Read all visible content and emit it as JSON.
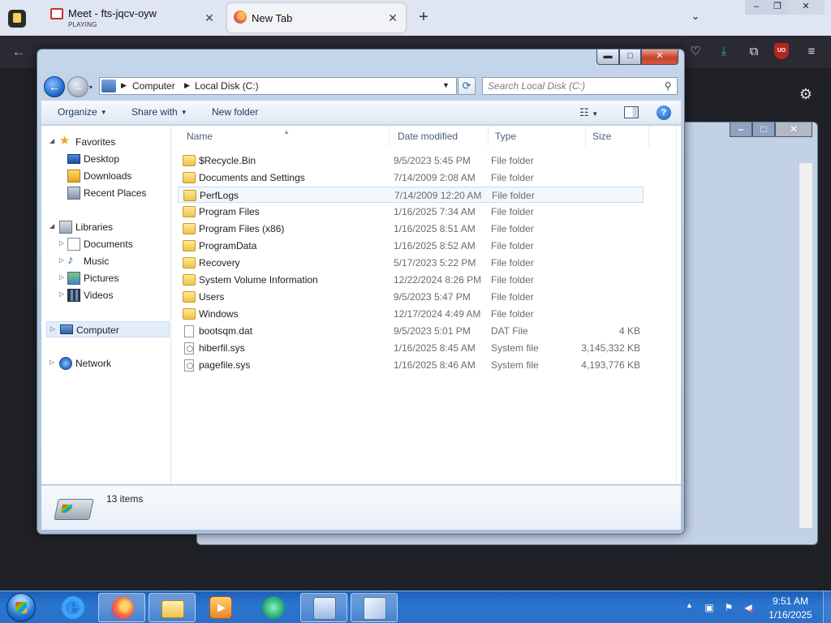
{
  "browser": {
    "tabs": [
      {
        "title": "Meet - fts-jqcv-oyw",
        "subtitle": "PLAYING",
        "active": false
      },
      {
        "title": "New Tab",
        "active": true
      }
    ],
    "icons": {
      "back": "arrow-left-icon",
      "pocket": "pocket-icon",
      "downloads": "download-arrow-icon",
      "extensions": "puzzle-icon",
      "ublock": "ublock-origin-icon",
      "menu": "hamburger-menu-icon",
      "settings": "gear-icon"
    },
    "ublock_label": "UO",
    "colors": {
      "tabbar": "#dfe6f2",
      "navbar": "#2b2a33",
      "content": "#1f2126",
      "accent": "#1fb3c7"
    }
  },
  "explorer": {
    "address": {
      "crumbs": [
        "Computer",
        "Local Disk (C:)"
      ]
    },
    "search": {
      "placeholder": "Search Local Disk (C:)"
    },
    "toolbar": {
      "organize": "Organize",
      "share_with": "Share with",
      "new_folder": "New folder"
    },
    "nav": {
      "favorites": {
        "label": "Favorites",
        "items": [
          "Desktop",
          "Downloads",
          "Recent Places"
        ]
      },
      "libraries": {
        "label": "Libraries",
        "items": [
          "Documents",
          "Music",
          "Pictures",
          "Videos"
        ]
      },
      "computer": "Computer",
      "network": "Network"
    },
    "columns": {
      "name": "Name",
      "date_modified": "Date modified",
      "type": "Type",
      "size": "Size"
    },
    "files": [
      {
        "name": "$Recycle.Bin",
        "date": "9/5/2023 5:45 PM",
        "type": "File folder",
        "size": "",
        "kind": "folder"
      },
      {
        "name": "Documents and Settings",
        "date": "7/14/2009 2:08 AM",
        "type": "File folder",
        "size": "",
        "kind": "folder"
      },
      {
        "name": "PerfLogs",
        "date": "7/14/2009 12:20 AM",
        "type": "File folder",
        "size": "",
        "kind": "folder",
        "highlighted": true
      },
      {
        "name": "Program Files",
        "date": "1/16/2025 7:34 AM",
        "type": "File folder",
        "size": "",
        "kind": "folder"
      },
      {
        "name": "Program Files (x86)",
        "date": "1/16/2025 8:51 AM",
        "type": "File folder",
        "size": "",
        "kind": "folder"
      },
      {
        "name": "ProgramData",
        "date": "1/16/2025 8:52 AM",
        "type": "File folder",
        "size": "",
        "kind": "folder"
      },
      {
        "name": "Recovery",
        "date": "5/17/2023 5:22 PM",
        "type": "File folder",
        "size": "",
        "kind": "folder"
      },
      {
        "name": "System Volume Information",
        "date": "12/22/2024 8:26 PM",
        "type": "File folder",
        "size": "",
        "kind": "folder"
      },
      {
        "name": "Users",
        "date": "9/5/2023 5:47 PM",
        "type": "File folder",
        "size": "",
        "kind": "folder"
      },
      {
        "name": "Windows",
        "date": "12/17/2024 4:49 AM",
        "type": "File folder",
        "size": "",
        "kind": "folder"
      },
      {
        "name": "bootsqm.dat",
        "date": "9/5/2023 5:01 PM",
        "type": "DAT File",
        "size": "4 KB",
        "kind": "file"
      },
      {
        "name": "hiberfil.sys",
        "date": "1/16/2025 8:45 AM",
        "type": "System file",
        "size": "3,145,332 KB",
        "kind": "sys"
      },
      {
        "name": "pagefile.sys",
        "date": "1/16/2025 8:46 AM",
        "type": "System file",
        "size": "4,193,776 KB",
        "kind": "sys"
      }
    ],
    "details": {
      "item_count": "13 items"
    },
    "colors": {
      "frame": "#b6c9e1",
      "selection": "#e3edf9",
      "close_button": "#c7432c"
    }
  },
  "taskbar": {
    "apps": [
      "internet-explorer-icon",
      "firefox-icon",
      "file-explorer-icon",
      "media-player-icon",
      "chat-app-icon",
      "control-panel-icon",
      "notepad-icon"
    ],
    "clock": {
      "time": "9:51 AM",
      "date": "1/16/2025"
    }
  }
}
